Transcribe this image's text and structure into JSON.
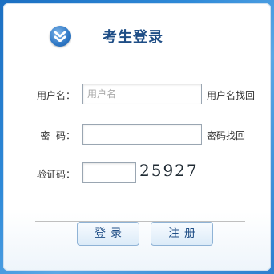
{
  "header": {
    "title": "考生登录",
    "icon": "download-arrow-icon"
  },
  "form": {
    "username": {
      "label": "用户名：",
      "placeholder": "用户名",
      "value": "",
      "link": "用户名找回"
    },
    "password": {
      "label": "密  码：",
      "value": "",
      "link": "密码找回"
    },
    "captcha": {
      "label": "验证码：",
      "value": "",
      "image_text": "25927"
    }
  },
  "actions": {
    "login_label": "登录",
    "register_label": "注册"
  },
  "colors": {
    "accent": "#1f4e86",
    "background": "#2f8ad8"
  }
}
